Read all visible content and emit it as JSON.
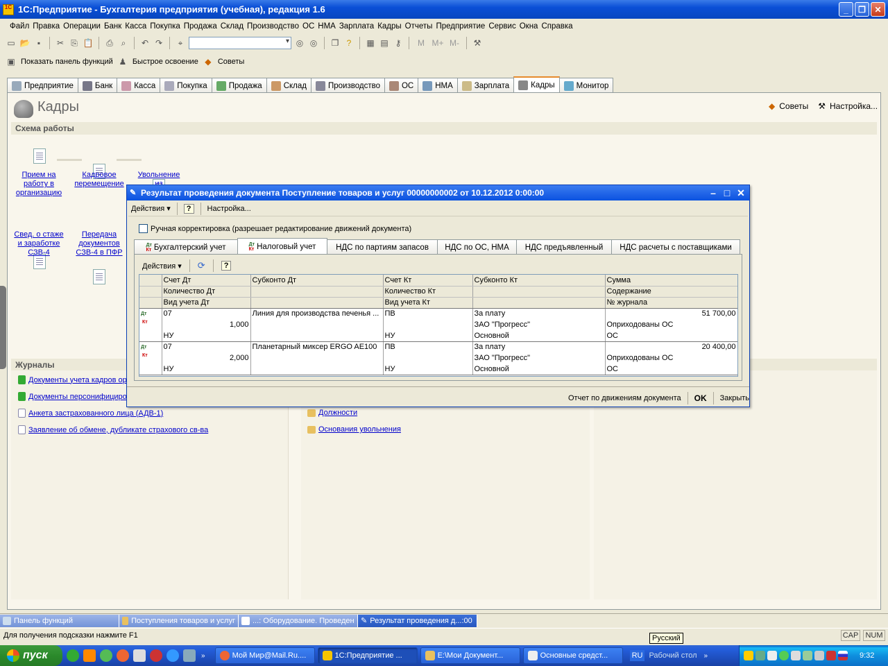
{
  "window": {
    "title": "1С:Предприятие - Бухгалтерия предприятия (учебная), редакция 1.6",
    "icon_text": "1C\nV8"
  },
  "menu": [
    "Файл",
    "Правка",
    "Операции",
    "Банк",
    "Касса",
    "Покупка",
    "Продажа",
    "Склад",
    "Производство",
    "ОС",
    "НМА",
    "Зарплата",
    "Кадры",
    "Отчеты",
    "Предприятие",
    "Сервис",
    "Окна",
    "Справка"
  ],
  "toolbar2": {
    "show_panel": "Показать панель функций",
    "quick_learn": "Быстрое освоение",
    "tips": "Советы"
  },
  "toolbar1": {
    "m_buttons": [
      "М",
      "М+",
      "М-"
    ]
  },
  "sections": [
    "Предприятие",
    "Банк",
    "Касса",
    "Покупка",
    "Продажа",
    "Склад",
    "Производство",
    "ОС",
    "НМА",
    "Зарплата",
    "Кадры",
    "Монитор"
  ],
  "active_section": "Кадры",
  "panel": {
    "title": "Кадры",
    "tips_btn": "Советы",
    "settings_btn": "Настройка...",
    "scheme_header": "Схема работы",
    "scheme_items": [
      {
        "l1": "Прием на",
        "l2": "работу в",
        "l3": "организацию"
      },
      {
        "l1": "Кадровое",
        "l2": "перемещение",
        "l3": ""
      },
      {
        "l1": "Увольнение",
        "l2": "из",
        "l3": ""
      },
      {
        "l1": "Свед. о стаже",
        "l2": "и заработке",
        "l3": "СЗВ-4"
      },
      {
        "l1": "Передача",
        "l2": "документов",
        "l3": "СЗВ-4 в ПФР"
      }
    ],
    "journals_header": "Журналы",
    "journals": [
      "Документы учета кадров ор",
      "Документы персонифициро",
      "Анкета застрахованного лица (АДВ-1)",
      "Заявление об обмене, дубликате страхового св-ва"
    ],
    "refs": [
      "Должности",
      "Основания увольнения"
    ]
  },
  "dialog": {
    "title": "Результат проведения документа Поступление товаров и услуг 00000000002 от 10.12.2012 0:00:00",
    "actions": "Действия",
    "help": "?",
    "settings": "Настройка...",
    "manual_checkbox": "Ручная корректировка (разрешает редактирование движений документа)",
    "tabs": [
      "Бухгалтерский учет",
      "Налоговый учет",
      "НДС по партиям запасов",
      "НДС по ОС, НМА",
      "НДС предъявленный",
      "НДС расчеты с поставщиками"
    ],
    "active_tab": "Налоговый учет",
    "inner_actions": "Действия",
    "columns": [
      [
        "Счет Дт",
        "Количество Дт",
        "Вид учета Дт"
      ],
      [
        "Субконто Дт",
        "",
        ""
      ],
      [
        "Счет Кт",
        "Количество Кт",
        "Вид учета Кт"
      ],
      [
        "Субконто Кт",
        "",
        ""
      ],
      [
        "Сумма",
        "Содержание",
        "№ журнала"
      ]
    ],
    "rows": [
      {
        "schet_dt": "07",
        "kol_dt": "1,000",
        "vid_dt": "НУ",
        "subk_dt": "Линия для производства печенья ...",
        "schet_kt": "ПВ",
        "vid_kt": "НУ",
        "subk_kt1": "За плату",
        "subk_kt2": "ЗАО \"Прогресс\"",
        "subk_kt3": "Основной",
        "summa": "51 700,00",
        "soderzh": "Оприходованы ОС",
        "journal": "ОС"
      },
      {
        "schet_dt": "07",
        "kol_dt": "2,000",
        "vid_dt": "НУ",
        "subk_dt": "Планетарный миксер ERGO AE100",
        "schet_kt": "ПВ",
        "vid_kt": "НУ",
        "subk_kt1": "За плату",
        "subk_kt2": "ЗАО \"Прогресс\"",
        "subk_kt3": "Основной",
        "summa": "20 400,00",
        "soderzh": "Оприходованы ОС",
        "journal": "ОС"
      }
    ],
    "row_marker": {
      "dt": "Дт",
      "kt": "Кт"
    },
    "report_btn": "Отчет по движениям документа",
    "ok_btn": "OK",
    "close_btn": "Закрыть"
  },
  "window_tabs": [
    "Панель функций",
    "Поступления товаров и услуг",
    "...: Оборудование. Проведен",
    "Результат проведения д...:00"
  ],
  "status": {
    "hint": "Для получения подсказки нажмите F1",
    "cap": "CAP",
    "num": "NUM",
    "tooltip": "Русский"
  },
  "taskbar": {
    "start": "пуск",
    "tasks": [
      "Мой Мир@Mail.Ru....",
      "1С:Предприятие ...",
      "E:\\Мои Документ...",
      "Основные средст..."
    ],
    "lang": "RU",
    "desktop": "Рабочий стол",
    "clock": "9:32"
  }
}
